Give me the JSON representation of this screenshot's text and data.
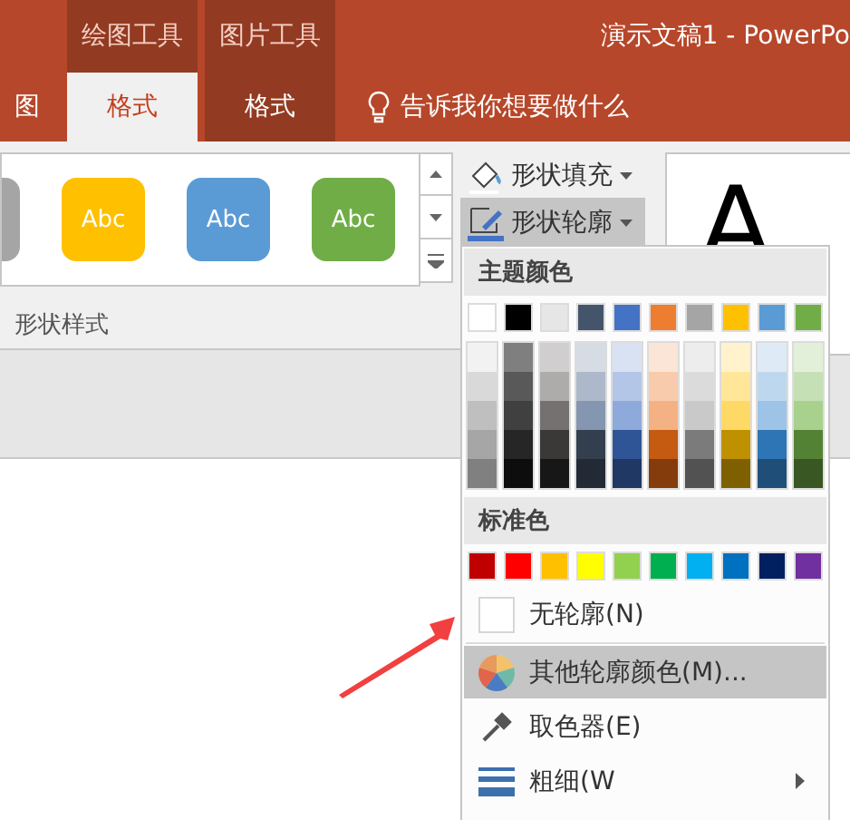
{
  "window": {
    "context_groups": [
      "绘图工具",
      "图片工具"
    ],
    "title": "演示文稿1 - PowerPo"
  },
  "tabs": [
    {
      "label": "图",
      "selected": false,
      "context": false
    },
    {
      "label": "格式",
      "selected": true,
      "context": true
    },
    {
      "label": "格式",
      "selected": false,
      "context": true
    }
  ],
  "tell_me": {
    "placeholder": "告诉我你想要做什么"
  },
  "shape_styles": {
    "items": [
      {
        "color": "#a5a5a5"
      },
      {
        "label": "Abc",
        "color": "#ffc000"
      },
      {
        "label": "Abc",
        "color": "#5b9bd5"
      },
      {
        "label": "Abc",
        "color": "#70ad47"
      }
    ],
    "group_label": "形状样式"
  },
  "shape_buttons": [
    {
      "label": "形状填充",
      "kind": "fill",
      "highlighted": false
    },
    {
      "label": "形状轮廓",
      "kind": "outline",
      "highlighted": true
    }
  ],
  "wordart": [
    {
      "label": "A",
      "color": "#000000"
    }
  ],
  "outline_menu": {
    "theme_header": "主题颜色",
    "theme_colors": [
      {
        "color": "#ffffff",
        "shades": [
          {
            "color": "#f2f2f2"
          },
          {
            "color": "#d9d9d9"
          },
          {
            "color": "#bfbfbf"
          },
          {
            "color": "#a6a6a6"
          },
          {
            "color": "#808080"
          }
        ]
      },
      {
        "color": "#000000",
        "shades": [
          {
            "color": "#7f7f7f"
          },
          {
            "color": "#595959"
          },
          {
            "color": "#404040"
          },
          {
            "color": "#262626"
          },
          {
            "color": "#0d0d0d"
          }
        ]
      },
      {
        "color": "#e7e6e6",
        "shades": [
          {
            "color": "#d0cece"
          },
          {
            "color": "#aeabab"
          },
          {
            "color": "#757171"
          },
          {
            "color": "#3b3838"
          },
          {
            "color": "#181717"
          }
        ]
      },
      {
        "color": "#44546a",
        "shades": [
          {
            "color": "#d6dce4"
          },
          {
            "color": "#adb9ca"
          },
          {
            "color": "#8496b0"
          },
          {
            "color": "#333f4f"
          },
          {
            "color": "#222a35"
          }
        ]
      },
      {
        "color": "#4472c4",
        "shades": [
          {
            "color": "#d9e2f3"
          },
          {
            "color": "#b4c6e7"
          },
          {
            "color": "#8eaadb"
          },
          {
            "color": "#2f5597"
          },
          {
            "color": "#1f3864"
          }
        ]
      },
      {
        "color": "#ed7d31",
        "shades": [
          {
            "color": "#fbe5d6"
          },
          {
            "color": "#f8cbad"
          },
          {
            "color": "#f4b183"
          },
          {
            "color": "#c55a11"
          },
          {
            "color": "#843c0c"
          }
        ]
      },
      {
        "color": "#a5a5a5",
        "shades": [
          {
            "color": "#ededed"
          },
          {
            "color": "#dbdbdb"
          },
          {
            "color": "#c9c9c9"
          },
          {
            "color": "#7b7b7b"
          },
          {
            "color": "#525252"
          }
        ]
      },
      {
        "color": "#ffc000",
        "shades": [
          {
            "color": "#fff2cc"
          },
          {
            "color": "#ffe699"
          },
          {
            "color": "#ffd966"
          },
          {
            "color": "#bf9000"
          },
          {
            "color": "#7f6000"
          }
        ]
      },
      {
        "color": "#5b9bd5",
        "shades": [
          {
            "color": "#deebf7"
          },
          {
            "color": "#bdd7ee"
          },
          {
            "color": "#9dc3e6"
          },
          {
            "color": "#2e75b6"
          },
          {
            "color": "#1f4e79"
          }
        ]
      },
      {
        "color": "#70ad47",
        "shades": [
          {
            "color": "#e2f0d9"
          },
          {
            "color": "#c5e0b4"
          },
          {
            "color": "#a9d18e"
          },
          {
            "color": "#548235"
          },
          {
            "color": "#385723"
          }
        ]
      }
    ],
    "standard_header": "标准色",
    "standard_colors": [
      {
        "color": "#c00000"
      },
      {
        "color": "#ff0000"
      },
      {
        "color": "#ffc000"
      },
      {
        "color": "#ffff00"
      },
      {
        "color": "#92d050"
      },
      {
        "color": "#00b050"
      },
      {
        "color": "#00b0f0"
      },
      {
        "color": "#0070c0"
      },
      {
        "color": "#002060"
      },
      {
        "color": "#7030a0"
      }
    ],
    "items": [
      {
        "kind": "none",
        "label": "无轮廓(N)",
        "highlighted": false,
        "submenu": false
      },
      {
        "kind": "more",
        "label": "其他轮廓颜色(M)...",
        "highlighted": true,
        "submenu": false
      },
      {
        "kind": "eyedropper",
        "label": "取色器(E)",
        "highlighted": false,
        "submenu": false
      },
      {
        "kind": "weight",
        "label": "粗细(W",
        "highlighted": false,
        "submenu": true
      }
    ]
  }
}
